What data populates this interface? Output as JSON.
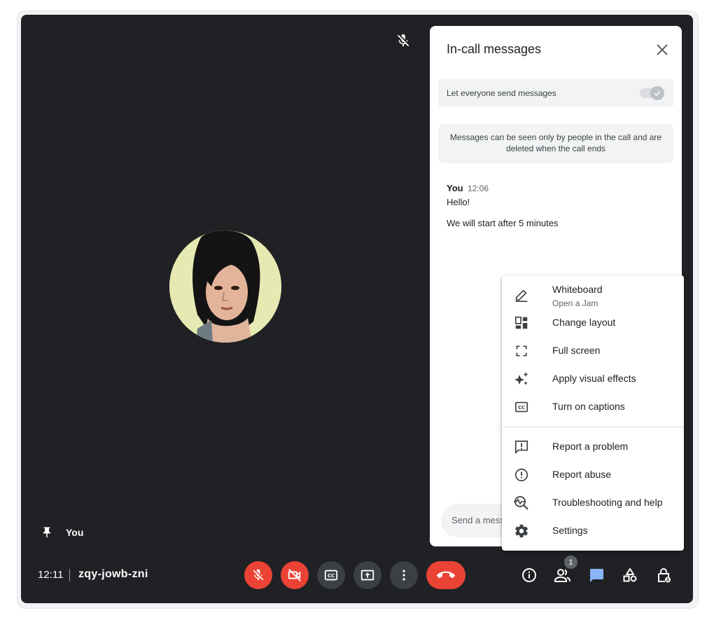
{
  "call": {
    "self_label": "You",
    "time": "12:11",
    "meeting_code": "zqy-jowb-zni",
    "participant_count": "1"
  },
  "controls": {
    "mic": {
      "icon": "mic-off-icon",
      "state": "muted",
      "color": "#ea4335"
    },
    "camera": {
      "icon": "videocam-off-icon",
      "state": "off",
      "color": "#ea4335"
    },
    "captions": {
      "icon": "closed-captions-icon"
    },
    "present": {
      "icon": "present-screen-icon"
    },
    "more": {
      "icon": "more-vertical-icon"
    },
    "hangup": {
      "icon": "call-end-icon",
      "color": "#ea4335"
    },
    "right": [
      {
        "icon": "info-icon"
      },
      {
        "icon": "people-icon"
      },
      {
        "icon": "chat-icon",
        "active_color": "#8ab4f8"
      },
      {
        "icon": "activities-icon"
      },
      {
        "icon": "host-controls-icon"
      }
    ]
  },
  "chat_panel": {
    "title": "In-call messages",
    "toggle_label": "Let everyone send messages",
    "toggle_on": true,
    "notice": "Messages can be seen only by people in the call and are deleted when the call ends",
    "messages": [
      {
        "sender": "You",
        "time": "12:06",
        "lines": [
          "Hello!",
          "We will start after 5 minutes"
        ]
      }
    ],
    "input_placeholder": "Send a message to everyone"
  },
  "menu": {
    "items": [
      {
        "label": "Whiteboard",
        "sublabel": "Open a Jam",
        "icon": "pencil-icon"
      },
      {
        "label": "Change layout",
        "icon": "layout-icon"
      },
      {
        "label": "Full screen",
        "icon": "fullscreen-icon"
      },
      {
        "label": "Apply visual effects",
        "icon": "sparkle-icon"
      },
      {
        "label": "Turn on captions",
        "icon": "captions-icon"
      },
      {
        "label": "Report a problem",
        "icon": "feedback-icon"
      },
      {
        "label": "Report abuse",
        "icon": "report-icon"
      },
      {
        "label": "Troubleshooting and help",
        "icon": "troubleshoot-icon"
      },
      {
        "label": "Settings",
        "icon": "gear-icon"
      }
    ]
  },
  "colors": {
    "stage_bg": "#202124",
    "control_bg": "#3c4043",
    "danger": "#ea4335",
    "accent": "#8ab4f8"
  }
}
